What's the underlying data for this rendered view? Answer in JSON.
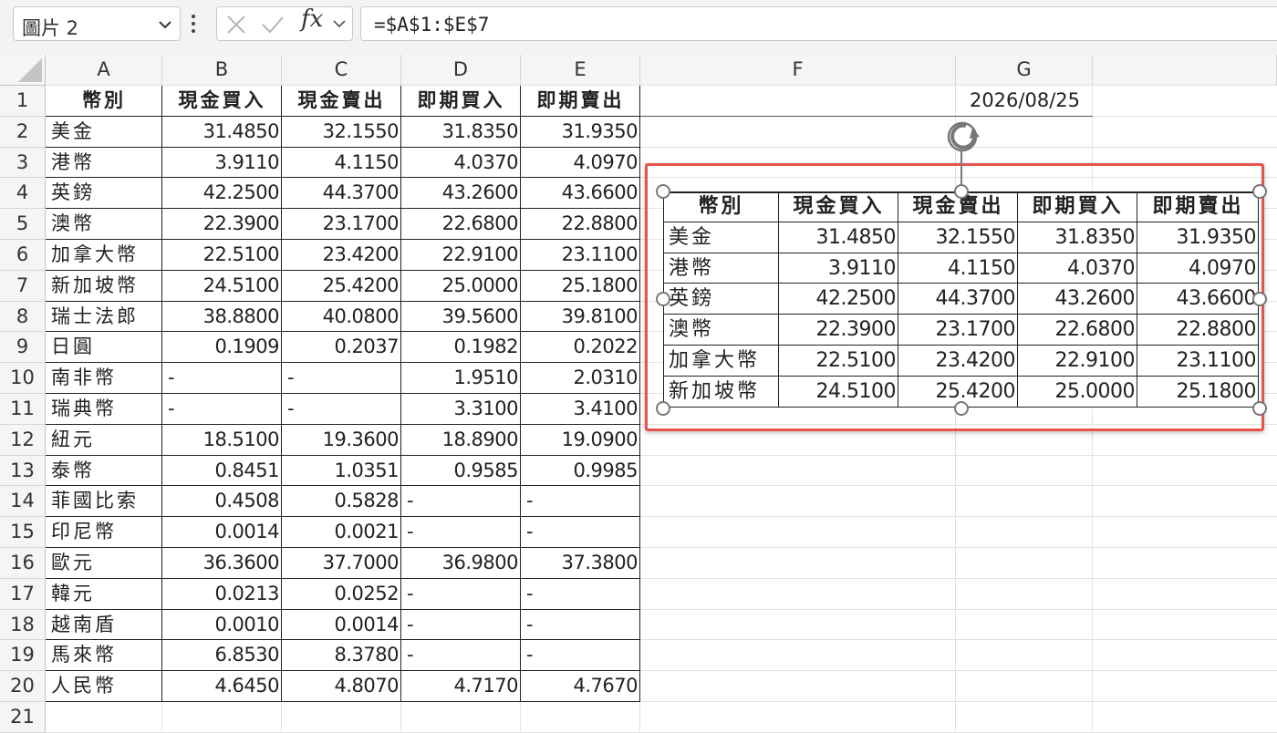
{
  "formula_bar": {
    "name_box": "圖片 2",
    "formula": "=$A$1:$E$7",
    "fx_label": "fx"
  },
  "columns": [
    "A",
    "B",
    "C",
    "D",
    "E",
    "F",
    "G"
  ],
  "rows": [
    "1",
    "2",
    "3",
    "4",
    "5",
    "6",
    "7",
    "8",
    "9",
    "10",
    "11",
    "12",
    "13",
    "14",
    "15",
    "16",
    "17",
    "18",
    "19",
    "20",
    "21"
  ],
  "sheet": {
    "header": [
      "幣別",
      "現金買入",
      "現金賣出",
      "即期買入",
      "即期賣出"
    ],
    "date": "2026/08/25",
    "data": [
      [
        "美金",
        "31.4850",
        "32.1550",
        "31.8350",
        "31.9350"
      ],
      [
        "港幣",
        "3.9110",
        "4.1150",
        "4.0370",
        "4.0970"
      ],
      [
        "英鎊",
        "42.2500",
        "44.3700",
        "43.2600",
        "43.6600"
      ],
      [
        "澳幣",
        "22.3900",
        "23.1700",
        "22.6800",
        "22.8800"
      ],
      [
        "加拿大幣",
        "22.5100",
        "23.4200",
        "22.9100",
        "23.1100"
      ],
      [
        "新加坡幣",
        "24.5100",
        "25.4200",
        "25.0000",
        "25.1800"
      ],
      [
        "瑞士法郎",
        "38.8800",
        "40.0800",
        "39.5600",
        "39.8100"
      ],
      [
        "日圓",
        "0.1909",
        "0.2037",
        "0.1982",
        "0.2022"
      ],
      [
        "南非幣",
        "-",
        "-",
        "1.9510",
        "2.0310"
      ],
      [
        "瑞典幣",
        "-",
        "-",
        "3.3100",
        "3.4100"
      ],
      [
        "紐元",
        "18.5100",
        "19.3600",
        "18.8900",
        "19.0900"
      ],
      [
        "泰幣",
        "0.8451",
        "1.0351",
        "0.9585",
        "0.9985"
      ],
      [
        "菲國比索",
        "0.4508",
        "0.5828",
        "-",
        "-"
      ],
      [
        "印尼幣",
        "0.0014",
        "0.0021",
        "-",
        "-"
      ],
      [
        "歐元",
        "36.3600",
        "37.7000",
        "36.9800",
        "37.3800"
      ],
      [
        "韓元",
        "0.0213",
        "0.0252",
        "-",
        "-"
      ],
      [
        "越南盾",
        "0.0010",
        "0.0014",
        "-",
        "-"
      ],
      [
        "馬來幣",
        "6.8530",
        "8.3780",
        "-",
        "-"
      ],
      [
        "人民幣",
        "4.6450",
        "4.8070",
        "4.7170",
        "4.7670"
      ]
    ]
  },
  "picture": {
    "name": "圖片 2",
    "header": [
      "幣別",
      "現金買入",
      "現金賣出",
      "即期買入",
      "即期賣出"
    ],
    "data": [
      [
        "美金",
        "31.4850",
        "32.1550",
        "31.8350",
        "31.9350"
      ],
      [
        "港幣",
        "3.9110",
        "4.1150",
        "4.0370",
        "4.0970"
      ],
      [
        "英鎊",
        "42.2500",
        "44.3700",
        "43.2600",
        "43.6600"
      ],
      [
        "澳幣",
        "22.3900",
        "23.1700",
        "22.6800",
        "22.8800"
      ],
      [
        "加拿大幣",
        "22.5100",
        "23.4200",
        "22.9100",
        "23.1100"
      ],
      [
        "新加坡幣",
        "24.5100",
        "25.4200",
        "25.0000",
        "25.1800"
      ]
    ]
  },
  "colors": {
    "selection": "#e5534b",
    "header_bg": "#f5f5f5",
    "gridline": "#e2e2e2",
    "border": "#222222"
  },
  "icons": [
    "chevron-down-icon",
    "more-vertical-icon",
    "cancel-x-icon",
    "enter-check-icon",
    "rotate-handle-icon"
  ]
}
